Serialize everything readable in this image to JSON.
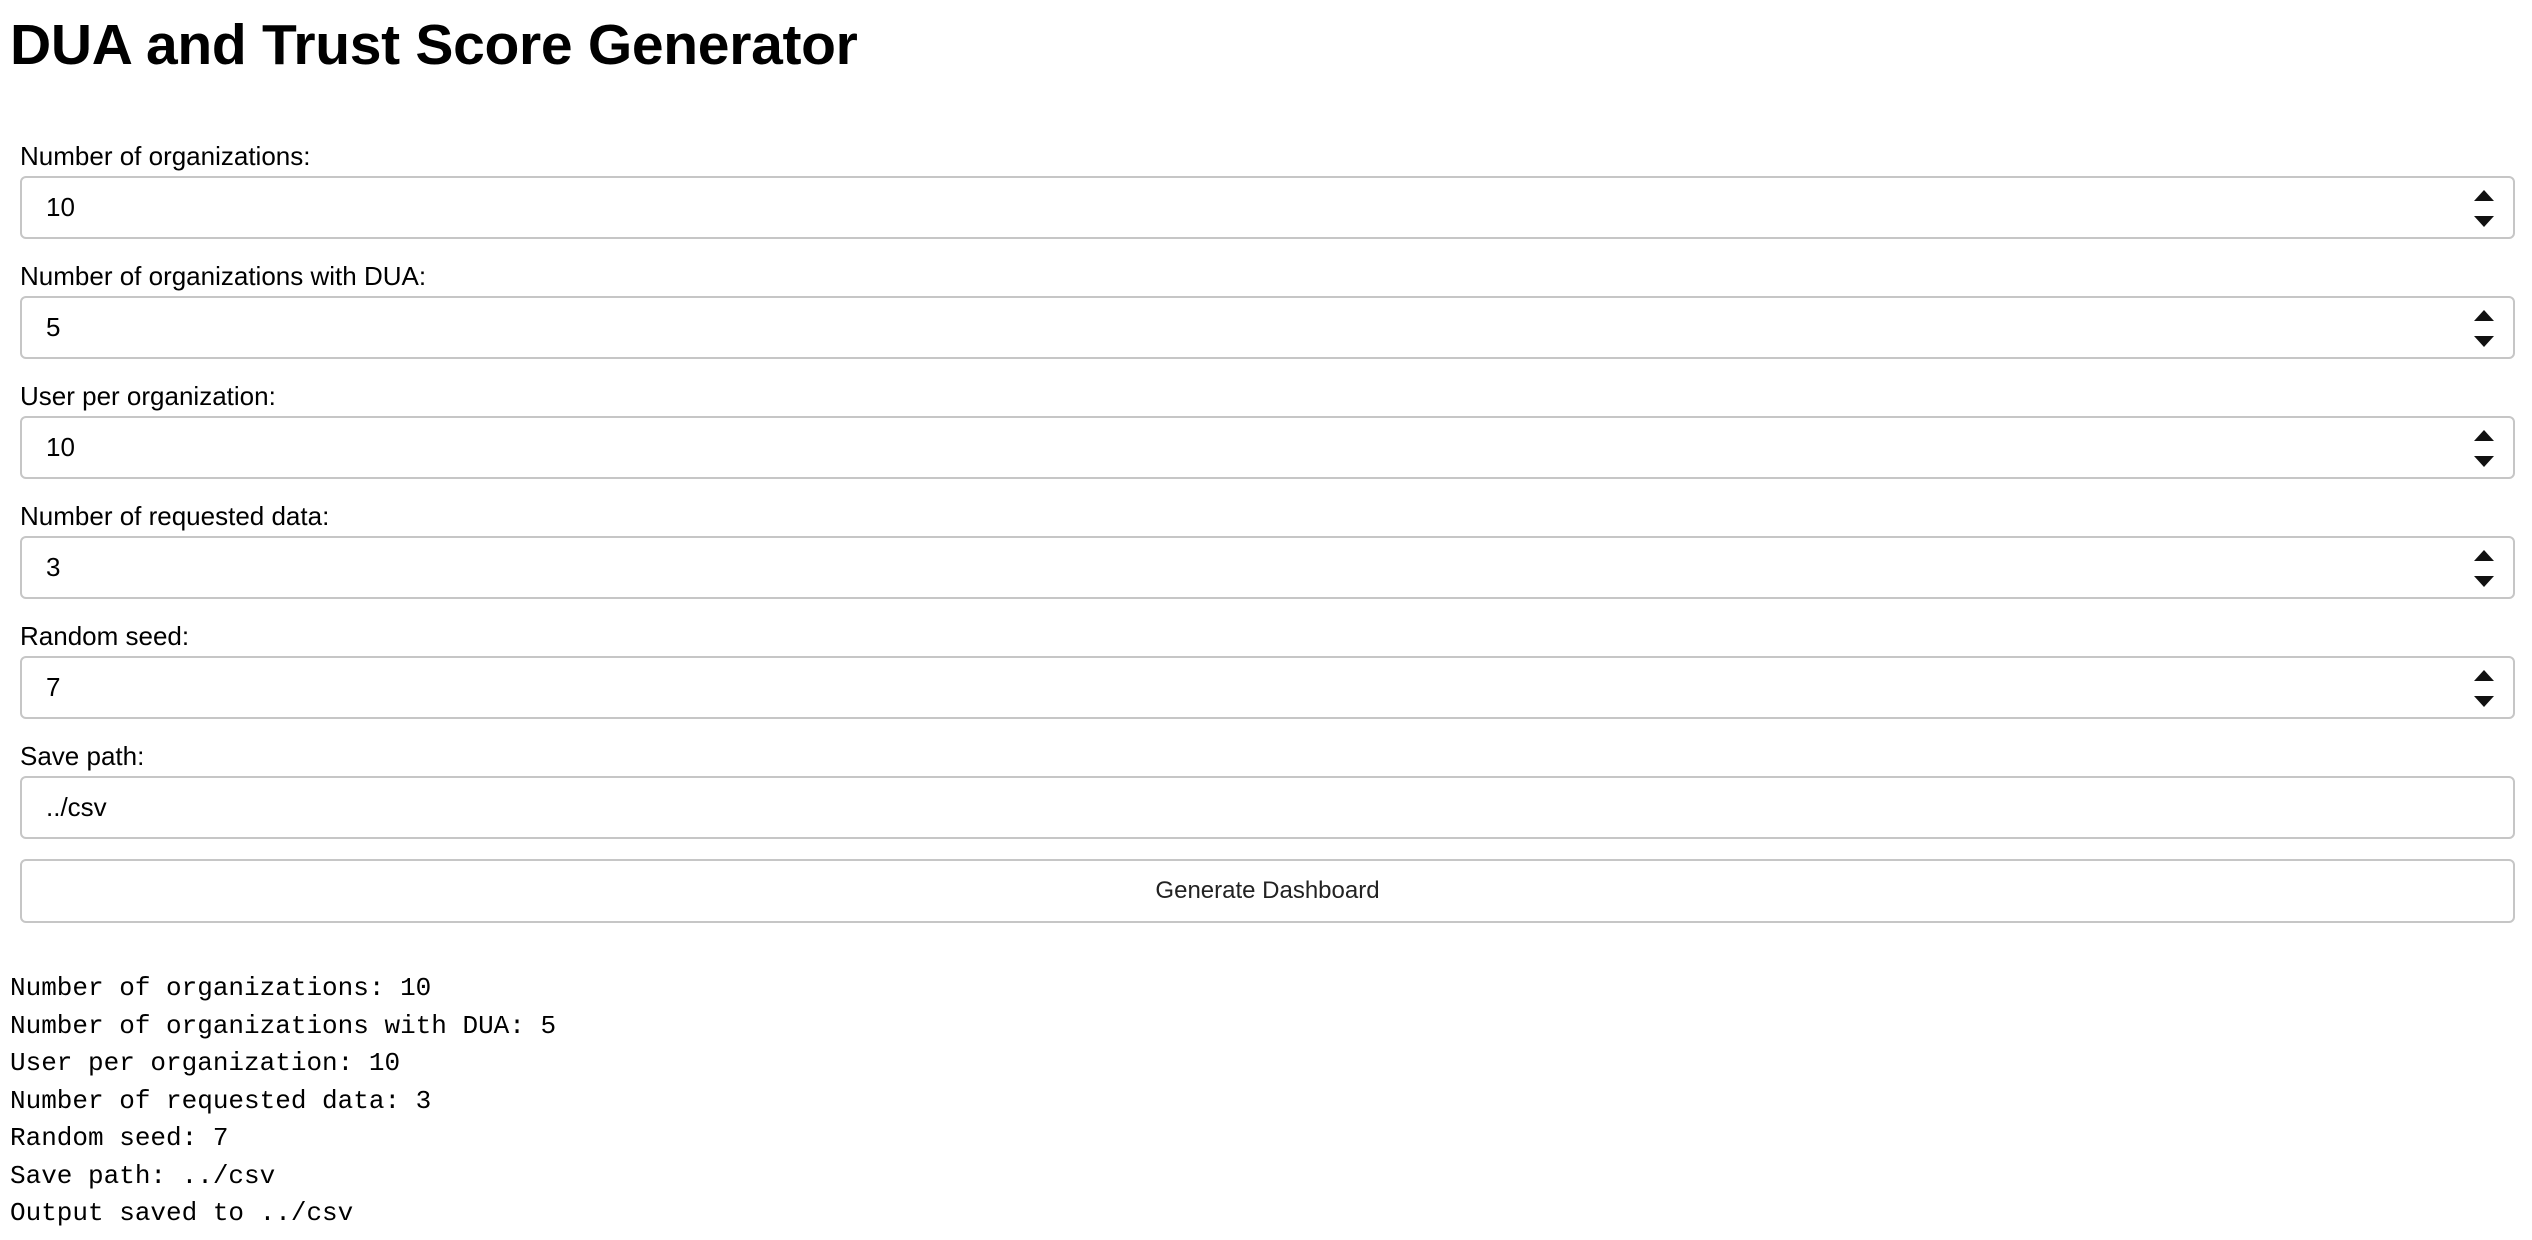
{
  "page": {
    "title": "DUA and Trust Score Generator"
  },
  "form": {
    "num_orgs": {
      "label": "Number of organizations:",
      "value": "10"
    },
    "num_orgs_dua": {
      "label": "Number of organizations with DUA:",
      "value": "5"
    },
    "users_per_org": {
      "label": "User per organization:",
      "value": "10"
    },
    "num_requested": {
      "label": "Number of requested data:",
      "value": "3"
    },
    "random_seed": {
      "label": "Random seed:",
      "value": "7"
    },
    "save_path": {
      "label": "Save path:",
      "value": "../csv"
    },
    "generate_label": "Generate Dashboard"
  },
  "output": {
    "lines": [
      "Number of organizations: 10",
      "Number of organizations with DUA: 5",
      "User per organization: 10",
      "Number of requested data: 3",
      "Random seed: 7",
      "Save path: ../csv",
      "Output saved to ../csv"
    ]
  },
  "icons": {
    "spinner_up": "triangle-up-icon",
    "spinner_down": "triangle-down-icon"
  }
}
